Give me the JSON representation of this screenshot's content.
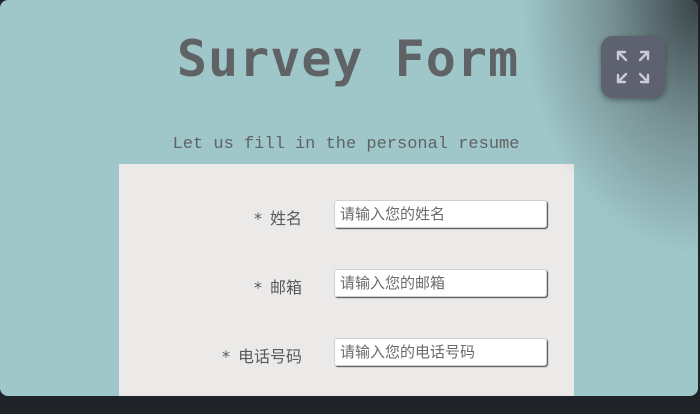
{
  "header": {
    "title": "Survey Form",
    "subtitle": "Let us fill in the personal resume"
  },
  "toolbar": {
    "fullscreen_icon": "expand-icon"
  },
  "form": {
    "fields": [
      {
        "required_mark": "*",
        "label": "姓名",
        "placeholder": "请输入您的姓名",
        "value": ""
      },
      {
        "required_mark": "*",
        "label": "邮箱",
        "placeholder": "请输入您的邮箱",
        "value": ""
      },
      {
        "required_mark": "*",
        "label": "电话号码",
        "placeholder": "请输入您的电话号码",
        "value": ""
      }
    ]
  },
  "colors": {
    "background": "#9fc7c9",
    "card": "#ebeae9",
    "text": "#5f6366",
    "button": "#5d6170"
  }
}
